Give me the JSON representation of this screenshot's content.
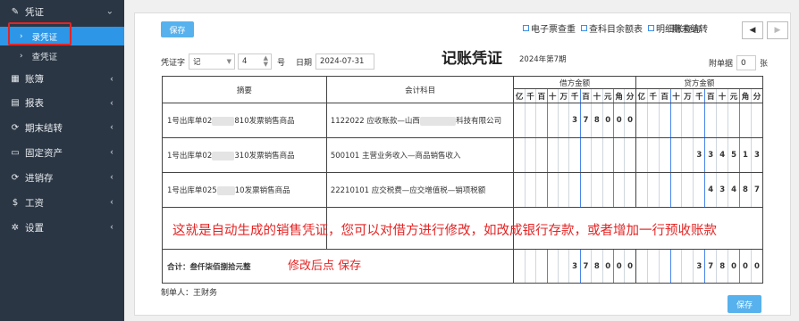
{
  "sidebar": {
    "items": [
      {
        "icon": "pencil-icon",
        "icon_glyph": "✎",
        "label": "凭证",
        "chev": "⌄"
      },
      {
        "icon": "book-icon",
        "icon_glyph": "▦",
        "label": "账簿",
        "chev": "‹"
      },
      {
        "icon": "report-icon",
        "icon_glyph": "▤",
        "label": "报表",
        "chev": "‹"
      },
      {
        "icon": "period-end-icon",
        "icon_glyph": "⟳",
        "label": "期末结转",
        "chev": "‹"
      },
      {
        "icon": "monitor-icon",
        "icon_glyph": "▭",
        "label": "固定资产",
        "chev": "‹"
      },
      {
        "icon": "inventory-icon",
        "icon_glyph": "⟳",
        "label": "进销存",
        "chev": "‹"
      },
      {
        "icon": "dollar-icon",
        "icon_glyph": "$",
        "label": "工资",
        "chev": "‹"
      },
      {
        "icon": "settings-icon",
        "icon_glyph": "✲",
        "label": "设置",
        "chev": "‹"
      }
    ],
    "sub_items": [
      {
        "label": "录凭证",
        "arrow": "›"
      },
      {
        "label": "查凭证",
        "arrow": "›"
      }
    ]
  },
  "toolbar": {
    "save_label": "保存",
    "links": [
      "电子票查重",
      "查科目余额表",
      "明细账查询"
    ],
    "period_end": "期末结转",
    "prev": "◀",
    "next": "▶"
  },
  "voucher_header": {
    "word_label": "凭证字",
    "word_value": "记",
    "number_value": "4",
    "number_suffix": "号",
    "date_label": "日期",
    "date_value": "2024-07-31",
    "title": "记账凭证",
    "period": "2024年第7期",
    "attach_label": "附单据",
    "attach_value": "0",
    "attach_unit": "张"
  },
  "table": {
    "col_summary": "摘要",
    "col_account": "会计科目",
    "col_debit": "借方金额",
    "col_credit": "贷方金额",
    "units": [
      "亿",
      "千",
      "百",
      "十",
      "万",
      "千",
      "百",
      "十",
      "元",
      "角",
      "分"
    ],
    "rows": [
      {
        "summary_a": "1号出库单02",
        "summary_blur": "xxxxx",
        "summary_b": "810发票销售商品",
        "account_a": "1122022 应收账款—山西",
        "account_blur": "xxxxxxxx",
        "account_b": "科技有限公司",
        "debit": "378000",
        "credit": ""
      },
      {
        "summary_a": "1号出库单02",
        "summary_blur": "xxxxx",
        "summary_b": "310发票销售商品",
        "account_a": "500101 主营业务收入—商品销售收入",
        "account_blur": "",
        "account_b": "",
        "debit": "",
        "credit": "334513"
      },
      {
        "summary_a": "1号出库单025",
        "summary_blur": "xxxx",
        "summary_b": "10发票销售商品",
        "account_a": "22210101 应交税费—应交增值税—销项税额",
        "account_blur": "",
        "account_b": "",
        "debit": "",
        "credit": "43487"
      }
    ],
    "total_label": "合计：叁仟柒佰捌拾元整",
    "total_debit": "378000",
    "total_credit": "378000"
  },
  "annotations": {
    "main_note": "这就是自动生成的销售凭证，您可以对借方进行修改，如改成银行存款，或者增加一行预收账款",
    "save_note": "修改后点  保存"
  },
  "footer": {
    "creator": "制单人：王财务",
    "save_label": "保存"
  }
}
